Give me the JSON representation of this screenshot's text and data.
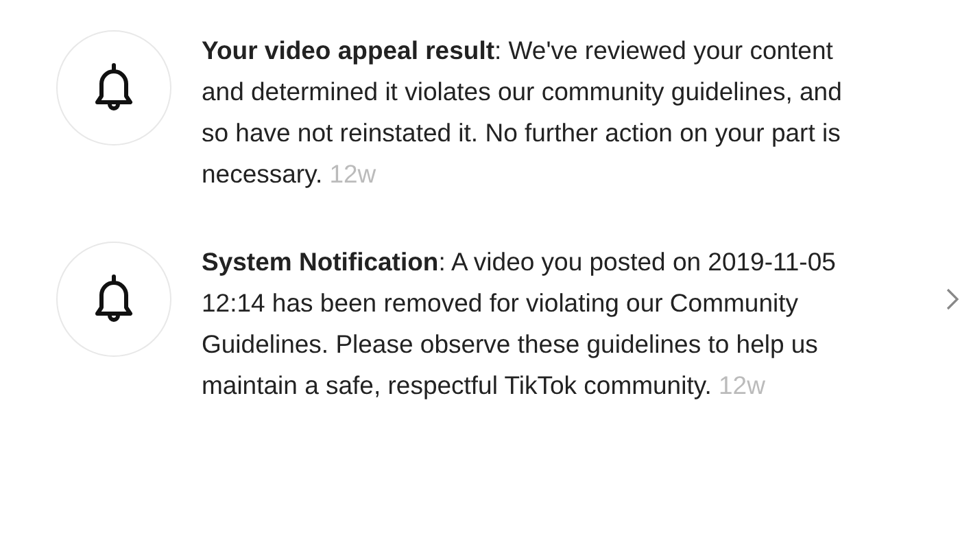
{
  "notifications": [
    {
      "message": "**Your video appeal result**: We've reviewed your content and determined it violates our community guidelines, and so have not reinstated it. No further action on your part is necessary.",
      "time": "12w",
      "chevron": false
    },
    {
      "message": "**System Notification**: A video you posted on 2019-11-05 12:14 has been removed for violating our Community Guidelines. Please observe these guidelines to help us maintain a safe, respectful TikTok community.",
      "time": "12w",
      "chevron": true
    }
  ]
}
